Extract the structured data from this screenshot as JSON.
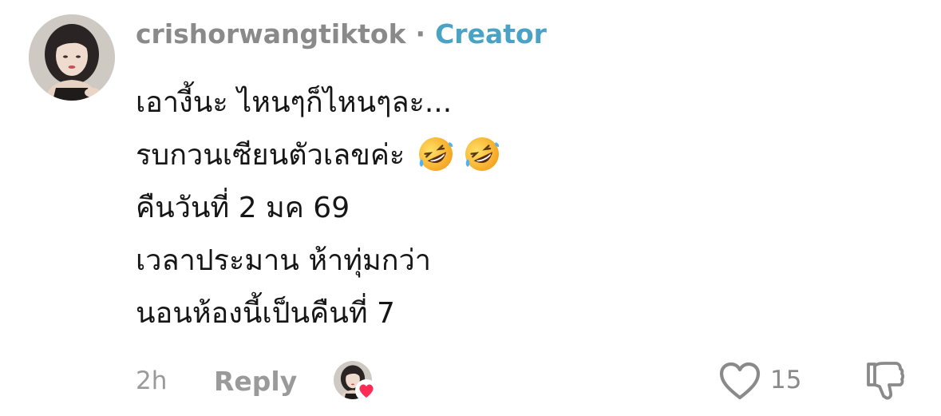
{
  "comment": {
    "username": "crishorwangtiktok",
    "separator": "·",
    "badge": "Creator",
    "lines": [
      "เอางี้นะ ไหนๆก็ไหนๆละ...",
      "รบกวนเซียนตัวเลขค่ะ",
      "คืนวันที่ 2 มค 69",
      "เวลาประมาน ห้าทุ่มกว่า",
      "นอนห้องนี้เป็นคืนที่ 7"
    ],
    "emojis": [
      "rolling-on-floor-laughing",
      "rolling-on-floor-laughing"
    ],
    "time": "2h",
    "reply_label": "Reply",
    "like_count": "15"
  },
  "colors": {
    "username": "#8a8a8a",
    "creator_badge": "#4aa3c4",
    "body_text": "#161616",
    "meta_text": "#9a9a9a",
    "heart_badge": "#fe2c55"
  },
  "icons": {
    "avatar": "user-avatar",
    "like": "heart-outline-icon",
    "dislike": "thumbs-down-outline-icon",
    "creator_liked": "creator-liked-heart-icon"
  }
}
